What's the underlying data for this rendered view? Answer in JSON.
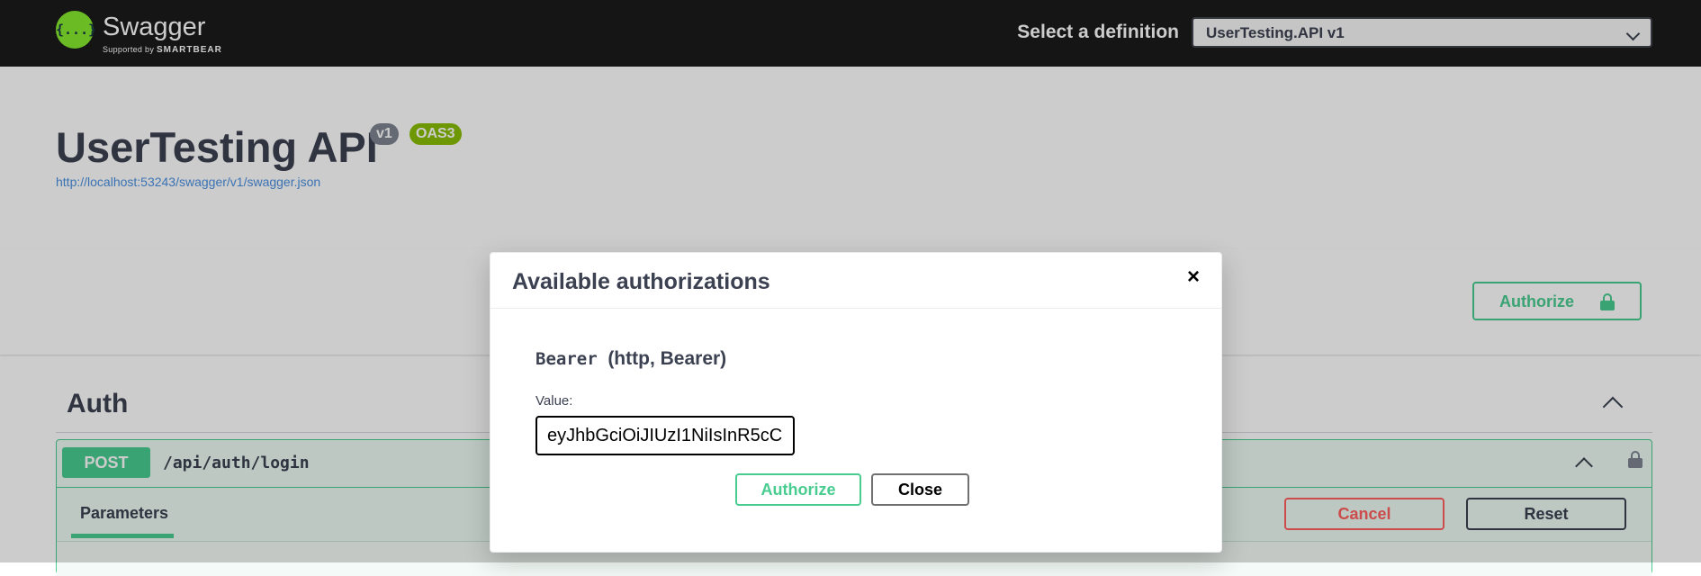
{
  "topbar": {
    "logo_name": "Swagger",
    "logo_supported_by": "Supported by",
    "logo_brand": "SMARTBEAR",
    "logo_mark": "{...}",
    "definition_label": "Select a definition",
    "definition_selected": "UserTesting.API v1"
  },
  "info": {
    "title": "UserTesting API",
    "version_badge": "v1",
    "oas_badge": "OAS3",
    "spec_url": "http://localhost:53243/swagger/v1/swagger.json"
  },
  "scheme_bar": {
    "authorize_label": "Authorize"
  },
  "section": {
    "title": "Auth",
    "operation": {
      "method": "POST",
      "path": "/api/auth/login",
      "tab": "Parameters",
      "cancel_label": "Cancel",
      "reset_label": "Reset"
    }
  },
  "modal": {
    "title": "Available authorizations",
    "close_glyph": "×",
    "scheme_name": "Bearer",
    "scheme_detail": "(http, Bearer)",
    "value_label": "Value:",
    "value": "eyJhbGciOiJIUzI1NiIsInR5cC",
    "authorize_label": "Authorize",
    "close_label": "Close"
  },
  "icons": {
    "lock": "lock-icon",
    "chevron_up": "chevron-up-icon",
    "chevron_down": "chevron-down-icon",
    "close": "close-icon"
  },
  "colors": {
    "topbar_bg": "#1b1b1b",
    "accent_green": "#49cc90",
    "logo_green": "#85ea2d",
    "cancel_red": "#ff6060",
    "link_blue": "#4990e2",
    "badge_grey": "#7d8492",
    "badge_olive": "#89bf04"
  }
}
